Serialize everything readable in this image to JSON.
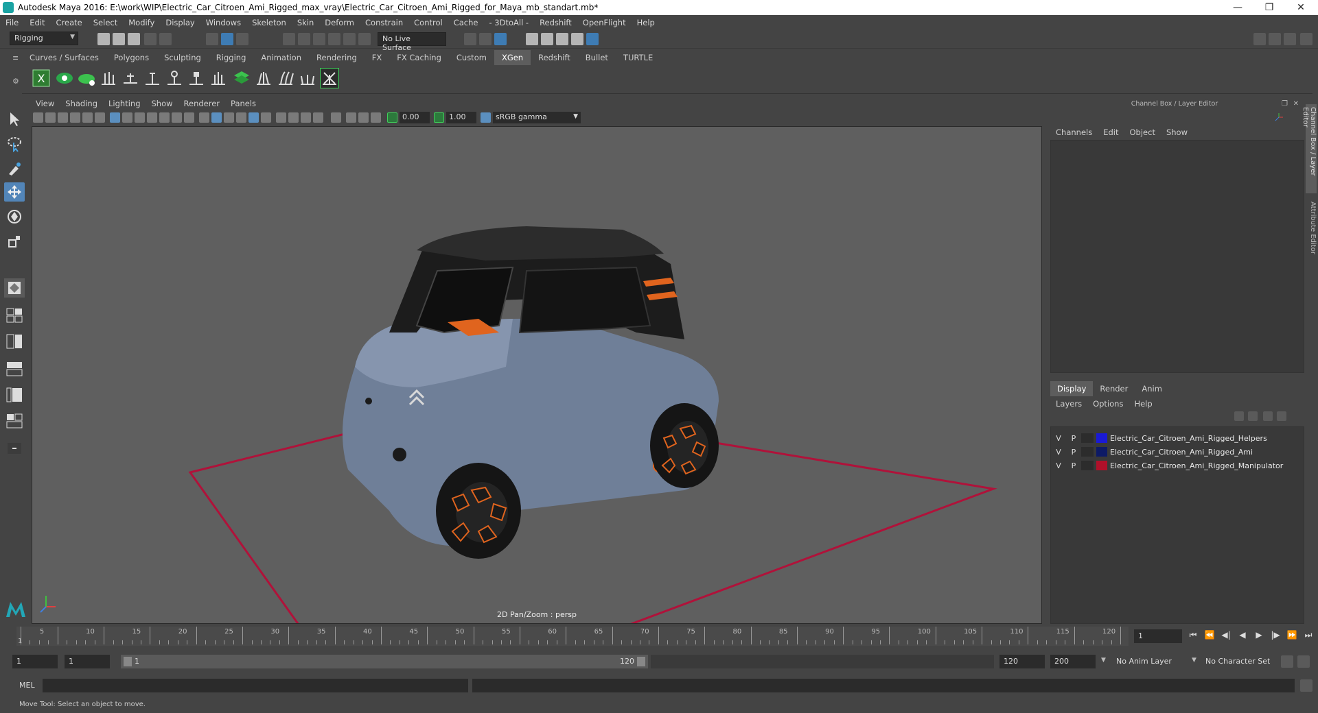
{
  "titlebar": {
    "title": "Autodesk Maya 2016: E:\\work\\WIP\\Electric_Car_Citroen_Ami_Rigged_max_vray\\Electric_Car_Citroen_Ami_Rigged_for_Maya_mb_standart.mb*",
    "minimize": "—",
    "restore": "❐",
    "close": "✕"
  },
  "menubar": [
    "File",
    "Edit",
    "Create",
    "Select",
    "Modify",
    "Display",
    "Windows",
    "Skeleton",
    "Skin",
    "Deform",
    "Constrain",
    "Control",
    "Cache",
    "- 3DtoAll -",
    "Redshift",
    "OpenFlight",
    "Help"
  ],
  "statusline": {
    "menuset": "Rigging",
    "live_surface": "No Live Surface"
  },
  "shelf_tabs": [
    "Curves / Surfaces",
    "Polygons",
    "Sculpting",
    "Rigging",
    "Animation",
    "Rendering",
    "FX",
    "FX Caching",
    "Custom",
    "XGen",
    "Redshift",
    "Bullet",
    "TURTLE"
  ],
  "shelf_active_tab": "XGen",
  "viewport": {
    "menu": [
      "View",
      "Shading",
      "Lighting",
      "Show",
      "Renderer",
      "Panels"
    ],
    "exposure": "0.00",
    "gamma": "1.00",
    "color_space": "sRGB gamma",
    "label": "2D Pan/Zoom : persp"
  },
  "channel_box": {
    "title": "Channel Box / Layer Editor",
    "menu": [
      "Channels",
      "Edit",
      "Object",
      "Show"
    ]
  },
  "layer_editor": {
    "tabs": [
      "Display",
      "Render",
      "Anim"
    ],
    "active_tab": "Display",
    "menu": [
      "Layers",
      "Options",
      "Help"
    ],
    "layers": [
      {
        "v": "V",
        "p": "P",
        "name": "Electric_Car_Citroen_Ami_Rigged_Helpers",
        "color": "#1a1ad6"
      },
      {
        "v": "V",
        "p": "P",
        "name": "Electric_Car_Citroen_Ami_Rigged_Ami",
        "color": "#0d1a66"
      },
      {
        "v": "V",
        "p": "P",
        "name": "Electric_Car_Citroen_Ami_Rigged_Manipulator",
        "color": "#b0102a"
      }
    ]
  },
  "side_rail": [
    "Channel Box / Layer Editor",
    "Attribute Editor"
  ],
  "timeline": {
    "ticks": [
      "5",
      "10",
      "15",
      "20",
      "25",
      "30",
      "35",
      "40",
      "45",
      "50",
      "55",
      "60",
      "65",
      "70",
      "75",
      "80",
      "85",
      "90",
      "95",
      "100",
      "105",
      "110",
      "115",
      "120"
    ],
    "first_tick": "1",
    "current_frame": "1"
  },
  "range": {
    "start": "1",
    "playback_start": "1",
    "slider_start": "1",
    "slider_end": "120",
    "playback_end": "120",
    "end": "200",
    "anim_layer": "No Anim Layer",
    "character_set": "No Character Set"
  },
  "cmdline": {
    "label": "MEL"
  },
  "helpline": {
    "text": "Move Tool: Select an object to move."
  },
  "colors": {
    "accent": "#5285b8",
    "grid_square": "#b0123a",
    "car_body": "#6f7f98",
    "car_trim": "#e0641e"
  }
}
